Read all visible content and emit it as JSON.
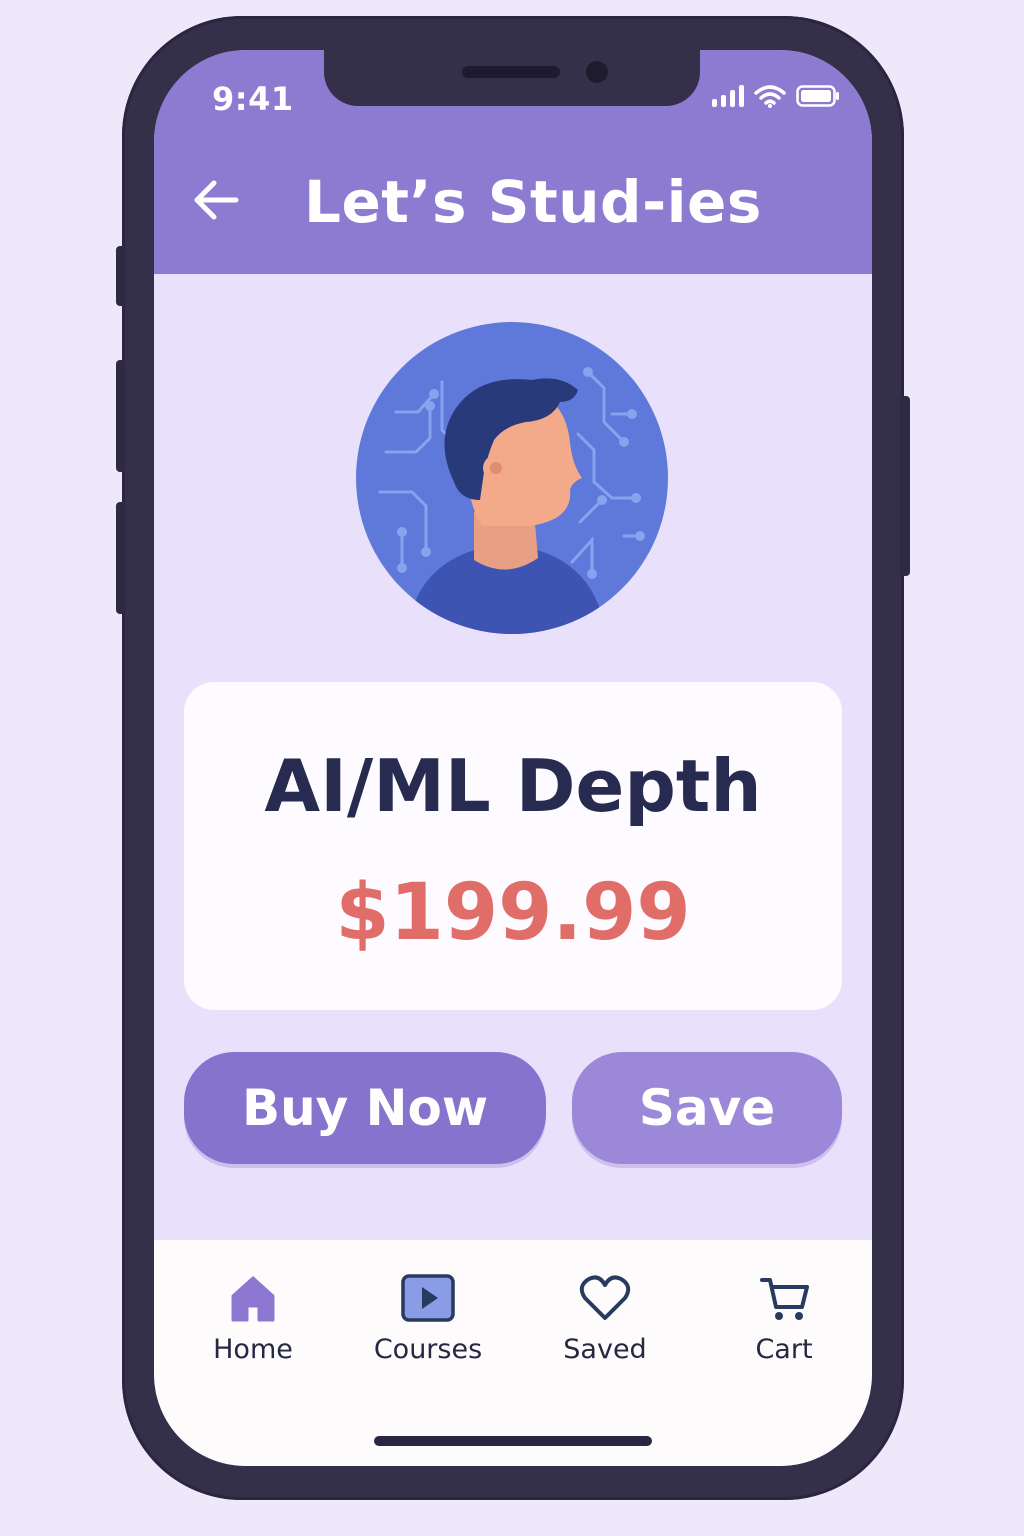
{
  "status_bar": {
    "time": "9:41",
    "icons": [
      "cellular-signal-icon",
      "wifi-icon",
      "battery-icon"
    ]
  },
  "header": {
    "back_icon": "back-arrow-icon",
    "title": "Let’s Stud-ies"
  },
  "course": {
    "image_icon": "ai-head-avatar-icon",
    "title": "AI/ML Depth",
    "price": "$199.99"
  },
  "actions": {
    "buy_label": "Buy Now",
    "save_label": "Save"
  },
  "tabbar": {
    "items": [
      {
        "label": "Home",
        "icon": "home-icon"
      },
      {
        "label": "Courses",
        "icon": "play-icon"
      },
      {
        "label": "Saved",
        "icon": "heart-icon"
      },
      {
        "label": "Cart",
        "icon": "cart-icon"
      }
    ]
  },
  "colors": {
    "header": "#8c7bd0",
    "background": "#e9e1fb",
    "buy_button": "#8573cd",
    "save_button": "#9b88d8",
    "price": "#e06d67",
    "title_text": "#272b4f"
  }
}
